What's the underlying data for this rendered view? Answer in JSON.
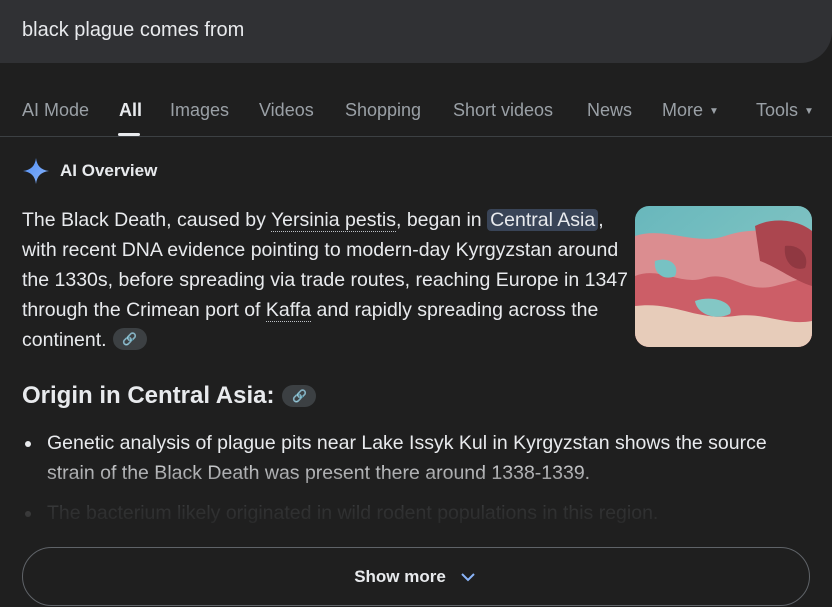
{
  "search": {
    "query": "black plague comes from"
  },
  "tabs": [
    {
      "label": "AI Mode"
    },
    {
      "label": "All"
    },
    {
      "label": "Images"
    },
    {
      "label": "Videos"
    },
    {
      "label": "Shopping"
    },
    {
      "label": "Short videos"
    },
    {
      "label": "News"
    },
    {
      "label": "More"
    },
    {
      "label": "Tools"
    }
  ],
  "ai_overview": {
    "label": "AI Overview",
    "para": {
      "p1": "The Black Death, caused by ",
      "link1": "Yersinia pestis",
      "p2": ", began in ",
      "highlight": "Central Asia",
      "p3": ", with recent DNA evidence pointing to modern-day Kyrgyzstan around the 1330s, before spreading via trade routes, reaching Europe in 1347 through the Crimean port of ",
      "link2": "Kaffa",
      "p4": " and rapidly spreading across the continent."
    },
    "section_title": "Origin in Central Asia:",
    "bullets": [
      "Genetic analysis of plague pits near Lake Issyk Kul in Kyrgyzstan shows the source strain of the Black Death was present there around 1338-1339.",
      "The bacterium likely originated in wild rodent populations in this region."
    ]
  },
  "show_more": {
    "label": "Show more"
  },
  "colors": {
    "background": "#1f1f1f",
    "search_bar": "#303134",
    "highlight": "#394457",
    "sparkle": "#8ab4f8"
  }
}
